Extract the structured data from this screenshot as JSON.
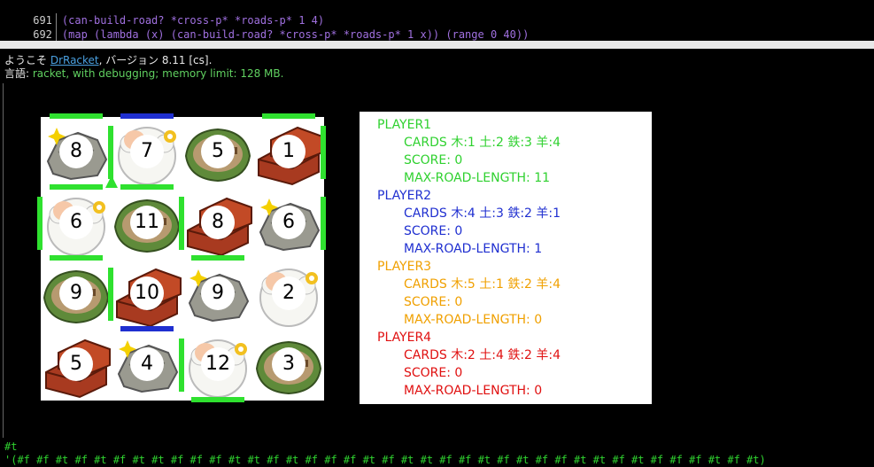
{
  "editor": {
    "lines": [
      {
        "no": "691",
        "code": "(can-build-road? *cross-p* *roads-p* 1 4)"
      },
      {
        "no": "692",
        "code": "(map (lambda (x) (can-build-road? *cross-p* *roads-p* 1 x)) (range 0 40))"
      },
      {
        "no": "693",
        "code": ""
      }
    ]
  },
  "welcome": {
    "prefix": "ようこそ ",
    "link": "DrRacket",
    "suffix": ", バージョン 8.11 [cs].",
    "lang_label": "言語: ",
    "lang": "racket, with debugging; memory limit: 128 MB."
  },
  "board": {
    "tiles": [
      {
        "row": 0,
        "col": 0,
        "resource": "rock",
        "number": "8"
      },
      {
        "row": 0,
        "col": 1,
        "resource": "sheep",
        "number": "7"
      },
      {
        "row": 0,
        "col": 2,
        "resource": "wood",
        "number": "5"
      },
      {
        "row": 0,
        "col": 3,
        "resource": "brick",
        "number": "1"
      },
      {
        "row": 1,
        "col": 0,
        "resource": "sheep",
        "number": "6"
      },
      {
        "row": 1,
        "col": 1,
        "resource": "wood",
        "number": "11"
      },
      {
        "row": 1,
        "col": 2,
        "resource": "brick",
        "number": "8"
      },
      {
        "row": 1,
        "col": 3,
        "resource": "rock",
        "number": "6"
      },
      {
        "row": 2,
        "col": 0,
        "resource": "wood",
        "number": "9"
      },
      {
        "row": 2,
        "col": 1,
        "resource": "brick",
        "number": "10"
      },
      {
        "row": 2,
        "col": 2,
        "resource": "rock",
        "number": "9"
      },
      {
        "row": 2,
        "col": 3,
        "resource": "sheep",
        "number": "2"
      },
      {
        "row": 3,
        "col": 0,
        "resource": "brick",
        "number": "5"
      },
      {
        "row": 3,
        "col": 1,
        "resource": "rock",
        "number": "4"
      },
      {
        "row": 3,
        "col": 2,
        "resource": "sheep",
        "number": "12"
      },
      {
        "row": 3,
        "col": 3,
        "resource": "wood",
        "number": "3"
      }
    ],
    "roads": [
      {
        "type": "h",
        "row": 0,
        "col": 0,
        "player": 1
      },
      {
        "type": "h",
        "row": 0,
        "col": 1,
        "player": 2
      },
      {
        "type": "h",
        "row": 0,
        "col": 3,
        "player": 1
      },
      {
        "type": "v",
        "row": 0,
        "col": 1,
        "player": 1
      },
      {
        "type": "v",
        "row": 0,
        "col": 4,
        "player": 1
      },
      {
        "type": "h",
        "row": 1,
        "col": 0,
        "player": 1
      },
      {
        "type": "h",
        "row": 1,
        "col": 1,
        "player": 1
      },
      {
        "type": "v",
        "row": 1,
        "col": 0,
        "player": 1
      },
      {
        "type": "v",
        "row": 1,
        "col": 2,
        "player": 1
      },
      {
        "type": "v",
        "row": 1,
        "col": 4,
        "player": 1
      },
      {
        "type": "h",
        "row": 2,
        "col": 0,
        "player": 1
      },
      {
        "type": "h",
        "row": 2,
        "col": 2,
        "player": 1
      },
      {
        "type": "v",
        "row": 2,
        "col": 1,
        "player": 1
      },
      {
        "type": "h",
        "row": 3,
        "col": 1,
        "player": 2
      },
      {
        "type": "v",
        "row": 3,
        "col": 2,
        "player": 1
      },
      {
        "type": "h",
        "row": 4,
        "col": 2,
        "player": 1
      }
    ],
    "settlements": [
      {
        "row": 1,
        "col": 1,
        "player": 1
      }
    ]
  },
  "player_colors": {
    "1": "#2fe12f",
    "2": "#1f2fd0",
    "3": "#f0a000",
    "4": "#e01010"
  },
  "players": [
    {
      "name": "PLAYER1",
      "color": "#2fd12f",
      "cards": "CARDS 木:1 土:2 鉄:3 羊:4",
      "score": "SCORE: 0",
      "road": "MAX-ROAD-LENGTH: 11"
    },
    {
      "name": "PLAYER2",
      "color": "#1f2fd0",
      "cards": "CARDS 木:4 土:3 鉄:2 羊:1",
      "score": "SCORE: 0",
      "road": "MAX-ROAD-LENGTH: 1"
    },
    {
      "name": "PLAYER3",
      "color": "#f0a000",
      "cards": "CARDS 木:5 土:1 鉄:2 羊:4",
      "score": "SCORE: 0",
      "road": "MAX-ROAD-LENGTH: 0"
    },
    {
      "name": "PLAYER4",
      "color": "#e01010",
      "cards": "CARDS 木:2 土:4 鉄:2 羊:4",
      "score": "SCORE: 0",
      "road": "MAX-ROAD-LENGTH: 0"
    }
  ],
  "repl": {
    "line1": "#t",
    "line2": "'(#f #f #t #f #t #f #t #t #f #f #f #t #t #f #t #f #f #f #t #f #t #t #f #f #t #f #t #f #f #t #t #f #t #f #f #f #t #f #t)"
  }
}
